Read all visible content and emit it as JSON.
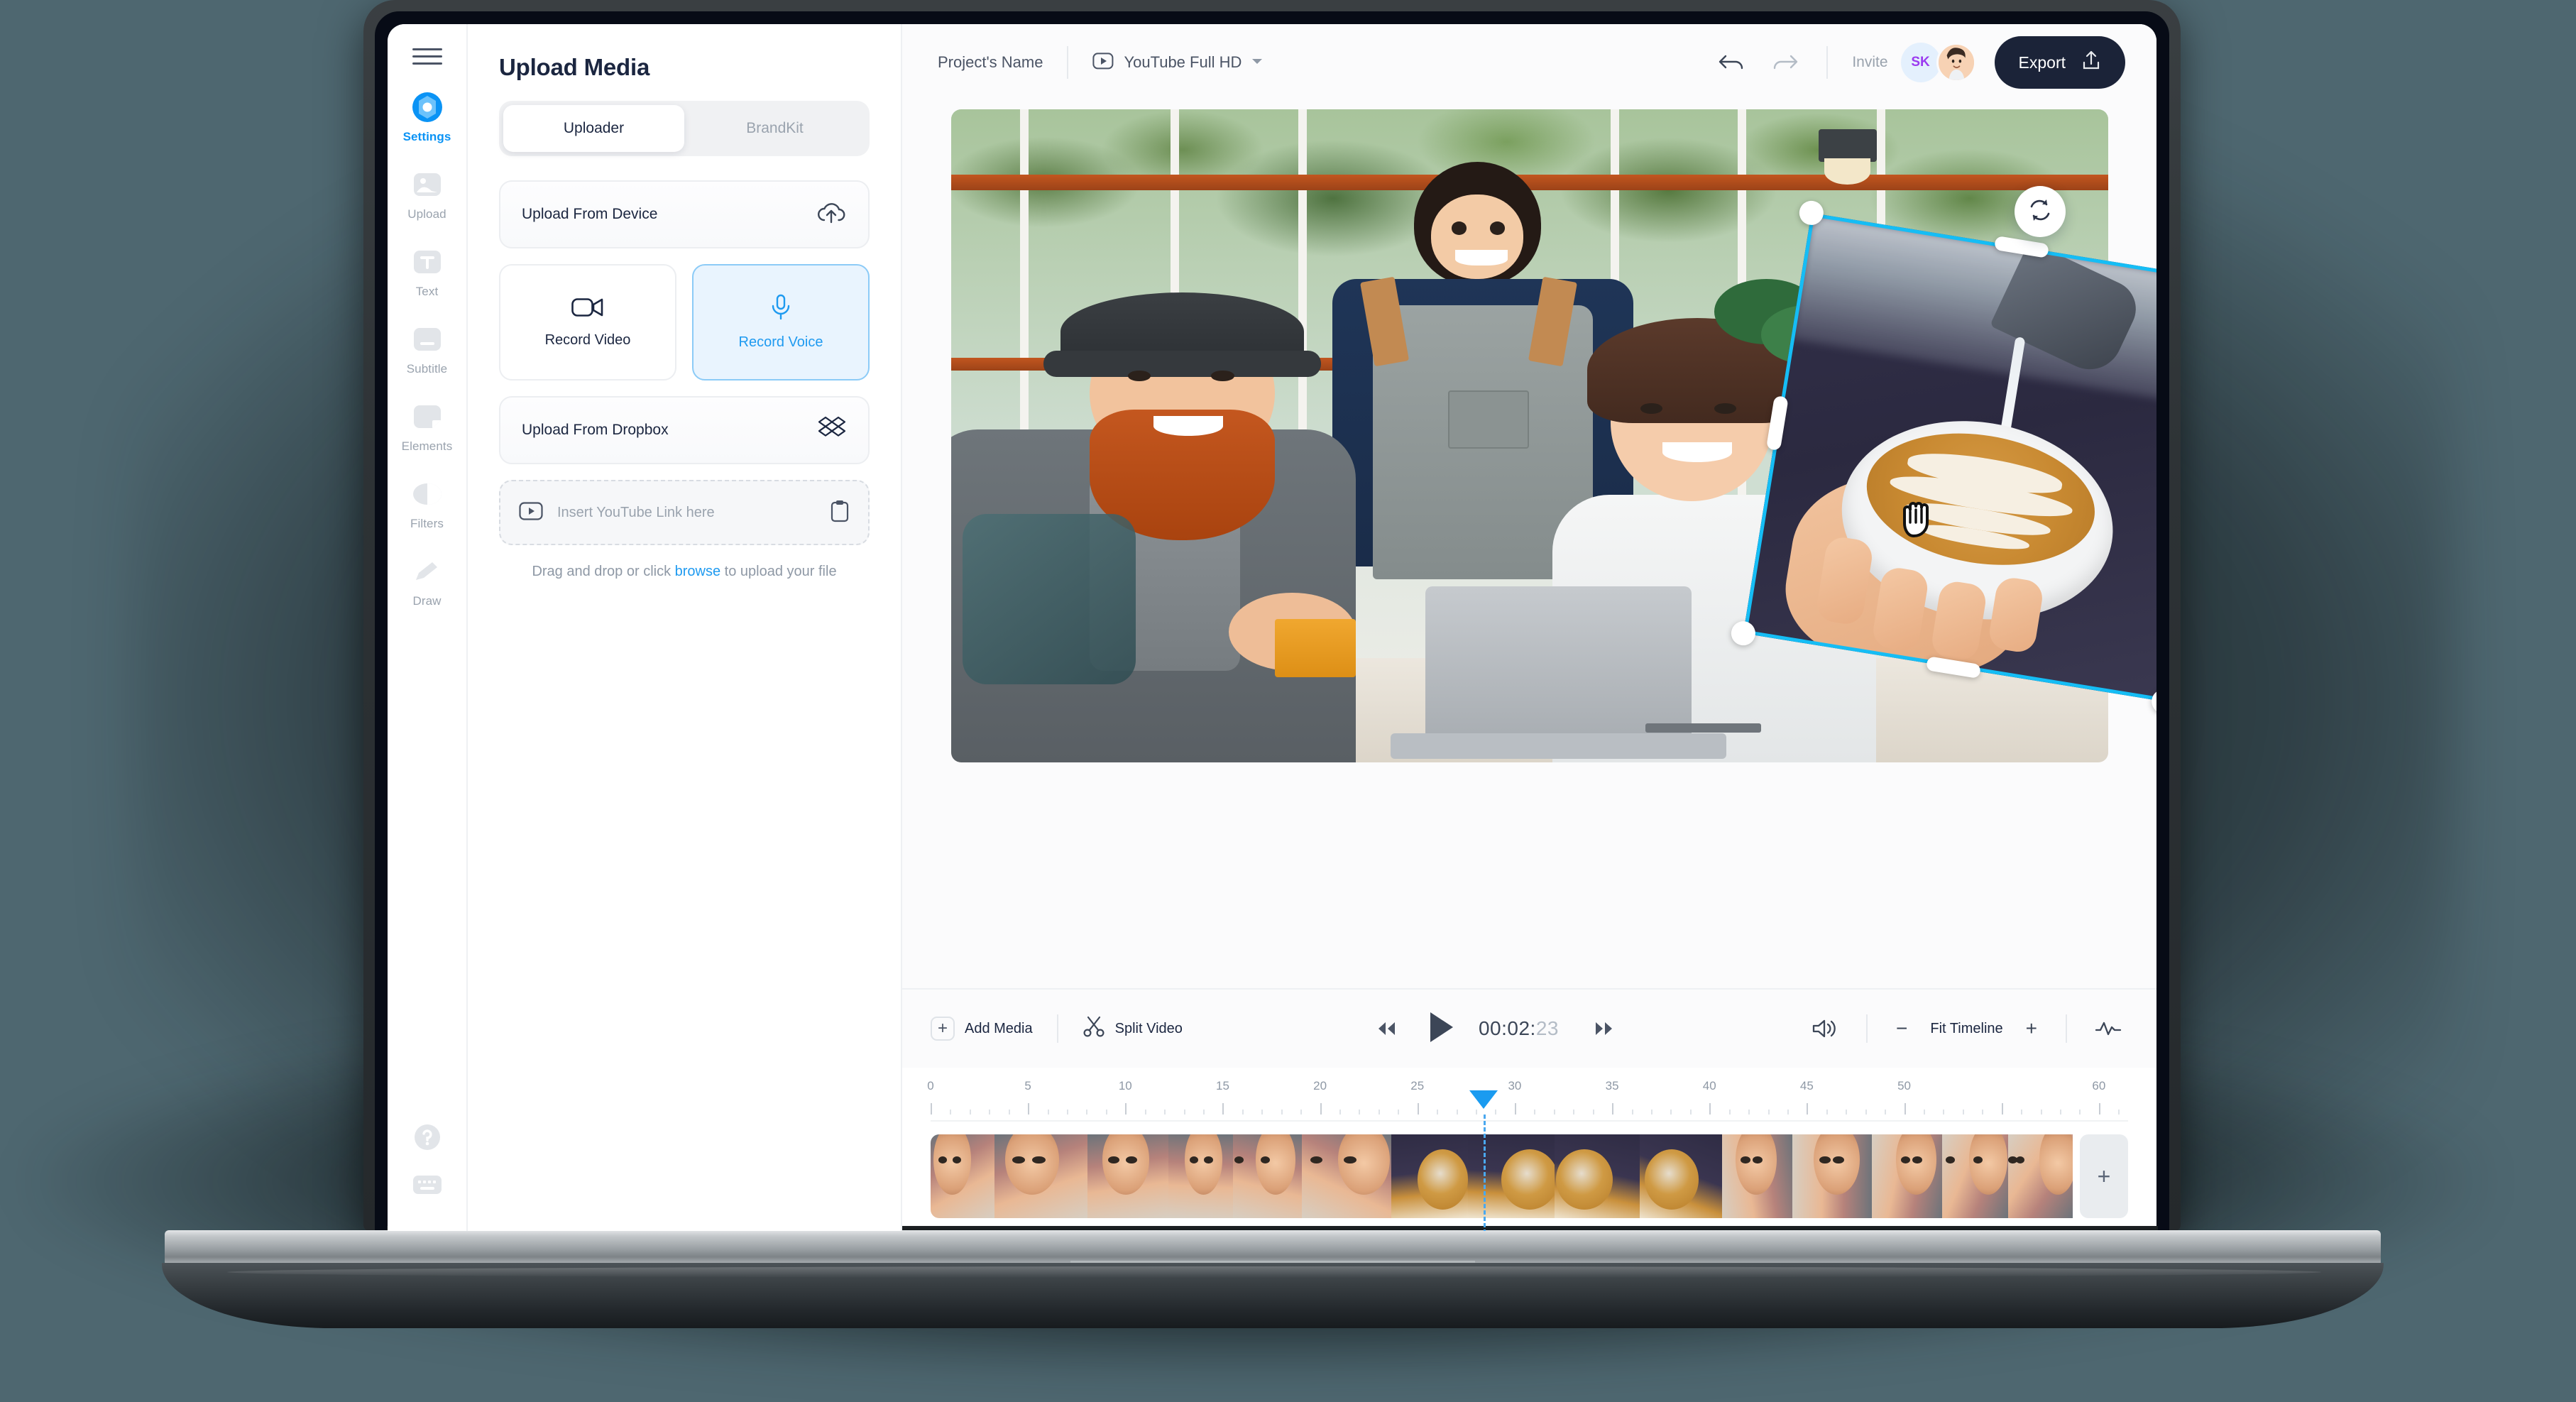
{
  "rail": {
    "menu_icon": "hamburger-icon",
    "items": [
      {
        "label": "Settings",
        "icon": "settings-gear-icon",
        "active": true
      },
      {
        "label": "Upload",
        "icon": "image-upload-icon",
        "active": false
      },
      {
        "label": "Text",
        "icon": "text-t-icon",
        "active": false
      },
      {
        "label": "Subtitle",
        "icon": "subtitle-icon",
        "active": false
      },
      {
        "label": "Elements",
        "icon": "elements-shape-icon",
        "active": false
      },
      {
        "label": "Filters",
        "icon": "filters-contrast-icon",
        "active": false
      },
      {
        "label": "Draw",
        "icon": "pencil-draw-icon",
        "active": false
      }
    ],
    "bottom": [
      {
        "icon": "help-question-icon"
      },
      {
        "icon": "keyboard-shortcuts-icon"
      }
    ]
  },
  "panel": {
    "title": "Upload Media",
    "tabs": [
      {
        "label": "Uploader",
        "active": true
      },
      {
        "label": "BrandKit",
        "active": false
      }
    ],
    "upload_from_device": {
      "label": "Upload From Device",
      "icon": "cloud-upload-icon"
    },
    "record_video": {
      "label": "Record Video",
      "icon": "video-camera-icon",
      "selected": false
    },
    "record_voice": {
      "label": "Record Voice",
      "icon": "microphone-icon",
      "selected": true
    },
    "upload_from_dropbox": {
      "label": "Upload From Dropbox",
      "icon": "dropbox-icon"
    },
    "youtube_link": {
      "icon": "youtube-play-icon",
      "value": "",
      "placeholder": "Insert YouTube Link here",
      "paste_icon": "clipboard-paste-icon"
    },
    "hint_before": "Drag and drop or click ",
    "hint_link": "browse",
    "hint_after": " to upload your file"
  },
  "topbar": {
    "project_name": "Project's Name",
    "preset_icon": "youtube-play-icon",
    "preset_label": "YouTube Full HD",
    "preset_caret": "chevron-down-icon",
    "undo_icon": "undo-arrow-icon",
    "redo_icon": "redo-arrow-icon",
    "invite_label": "Invite",
    "avatar_initials": "SK",
    "export_label": "Export",
    "export_icon": "share-upload-icon"
  },
  "canvas": {
    "background_clip": "cafe-team-photo",
    "selected_layer": {
      "name": "latte-coffee-photo",
      "rotation_deg": 9.2,
      "rotate_icon": "rotate-refresh-icon",
      "cursor": "grab-hand-cursor",
      "frame_color": "#15bdf5"
    }
  },
  "transport": {
    "add_media": {
      "label": "Add Media",
      "icon": "plus-icon"
    },
    "split_video": {
      "label": "Split Video",
      "icon": "scissors-icon"
    },
    "skip_back_icon": "skip-back-icon",
    "play_icon": "play-icon",
    "skip_forward_icon": "skip-forward-icon",
    "timecode_main": "00:02:",
    "timecode_frames": "23",
    "volume_icon": "speaker-volume-icon",
    "zoom_out_icon": "minus-icon",
    "zoom_label": "Fit Timeline",
    "zoom_in_icon": "plus-icon",
    "waveform_icon": "audio-waveform-icon"
  },
  "timeline": {
    "tick_labels": [
      "0",
      "5",
      "10",
      "15",
      "20",
      "25",
      "30",
      "35",
      "40",
      "45",
      "50",
      "60"
    ],
    "tick_positions": [
      0,
      5,
      10,
      15,
      20,
      25,
      30,
      35,
      40,
      45,
      50,
      60
    ],
    "range_start": 0,
    "range_end": 61.5,
    "playhead_seconds": 28.4,
    "playhead_color": "#1a9bf0",
    "add_clip_icon": "plus-icon",
    "clips": [
      {
        "w": 118,
        "kind": "cafe"
      },
      {
        "w": 172,
        "kind": "cafe"
      },
      {
        "w": 150,
        "kind": "cafe"
      },
      {
        "w": 120,
        "kind": "cafe"
      },
      {
        "w": 128,
        "kind": "cafe"
      },
      {
        "w": 166,
        "kind": "cafe"
      },
      {
        "w": 142,
        "kind": "latte"
      },
      {
        "w": 160,
        "kind": "latte"
      },
      {
        "w": 158,
        "kind": "latte"
      },
      {
        "w": 152,
        "kind": "latte"
      },
      {
        "w": 130,
        "kind": "cafe"
      },
      {
        "w": 148,
        "kind": "cafe"
      },
      {
        "w": 130,
        "kind": "cafe"
      },
      {
        "w": 122,
        "kind": "cafe"
      },
      {
        "w": 120,
        "kind": "cafe"
      }
    ]
  },
  "colors": {
    "accent_blue": "#0a93f5",
    "selection_cyan": "#15bdf5",
    "export_navy": "#1b2338",
    "text_dark": "#1b2640",
    "text_muted": "#9aa3ae",
    "backdrop": "#4e6770"
  }
}
